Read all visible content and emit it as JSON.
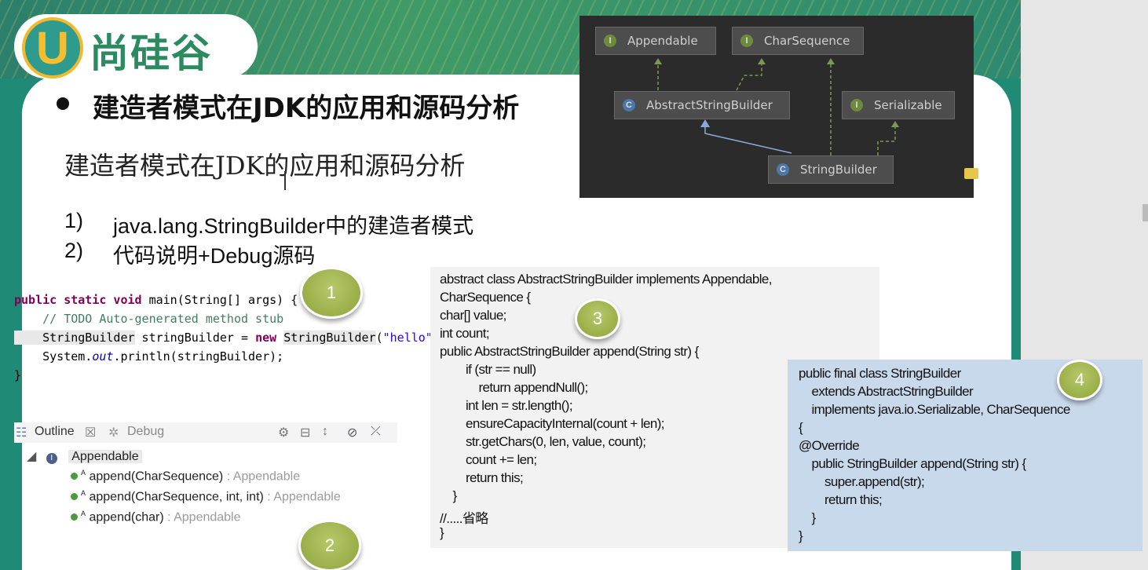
{
  "logo": {
    "letter": "U",
    "name": "尚硅谷"
  },
  "heading": "建造者模式在JDK的应用和源码分析",
  "subheading": "建造者模式在JDK的应用和源码分析",
  "list": [
    {
      "num": "1)",
      "text": "java.lang.StringBuilder中的建造者模式"
    },
    {
      "num": "2)",
      "text": "代码说明+Debug源码"
    }
  ],
  "diagram": {
    "boxes": {
      "appendable": "Appendable",
      "charsequence": "CharSequence",
      "abstractsb": "AbstractStringBuilder",
      "serializable": "Serializable",
      "stringbuilder": "StringBuilder"
    },
    "interface_icon": "I",
    "class_icon": "C"
  },
  "code_main": {
    "l1a": "public static void ",
    "l1b": "main(String[] args) {",
    "l2": "    // TODO Auto-generated method stub",
    "l3a": "    StringBuilder",
    "l3b": " stringBuilder = ",
    "l3c": "new ",
    "l3d": "StringBuilder",
    "l3e": "(",
    "l3f": "\"hello\"",
    "l3g": ");",
    "l4a": "    System.",
    "l4b": "out",
    "l4c": ".println(stringBuilder);",
    "l5": "}"
  },
  "outline": {
    "tab_outline": "Outline",
    "tab_close": "☒",
    "tab_debug": "Debug",
    "root_icon": "I",
    "root": "Appendable",
    "items": [
      {
        "name": "append(CharSequence)",
        "type": " : Appendable"
      },
      {
        "name": "append(CharSequence, int, int)",
        "type": " : Appendable"
      },
      {
        "name": "append(char)",
        "type": " : Appendable"
      }
    ],
    "superscript": "A"
  },
  "code3": [
    "abstract class AbstractStringBuilder implements Appendable,",
    "CharSequence {",
    "char[] value;",
    "int count;",
    "public AbstractStringBuilder append(String str) {",
    "        if (str == null)",
    "            return appendNull();",
    "        int len = str.length();",
    "        ensureCapacityInternal(count + len);",
    "        str.getChars(0, len, value, count);",
    "        count += len;",
    "        return this;",
    "    }",
    "//.....省略",
    "}"
  ],
  "code4": [
    "public final class StringBuilder",
    "    extends AbstractStringBuilder",
    "    implements java.io.Serializable, CharSequence",
    "{",
    "@Override",
    "    public StringBuilder append(String str) {",
    "        super.append(str);",
    "        return this;",
    "    }",
    "}"
  ],
  "badges": {
    "b1": "1",
    "b2": "2",
    "b3": "3",
    "b4": "4"
  },
  "colors": {
    "slide_bg": "#1f8a76",
    "badge": "#9db14a",
    "code4_bg": "#c9d9ec"
  }
}
